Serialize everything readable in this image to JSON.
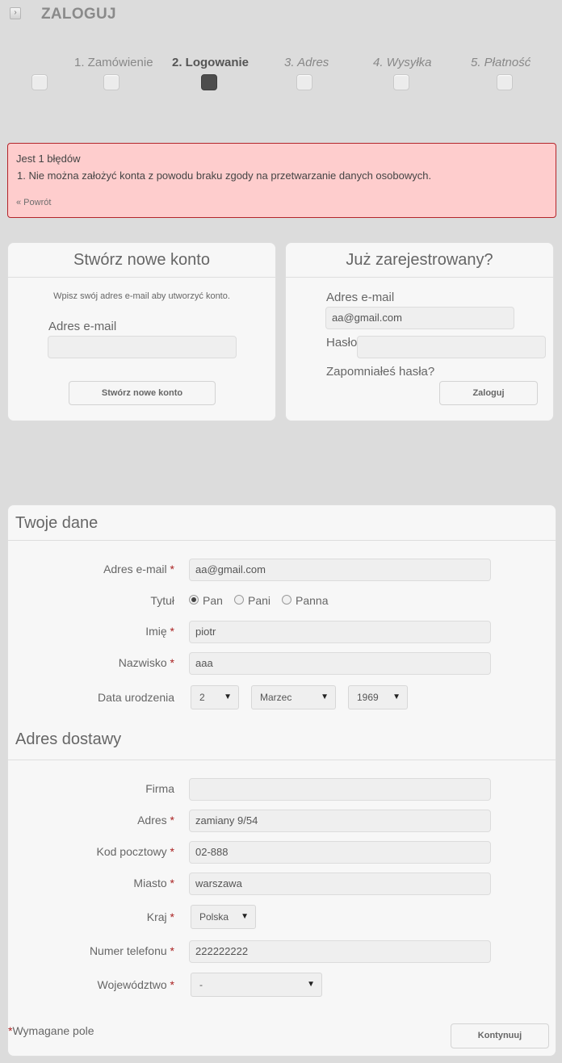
{
  "header": {
    "back_icon": "chevron-right-icon",
    "back_glyph": "›",
    "title": "ZALOGUJ"
  },
  "steps": [
    {
      "label": "1. Zamówienie",
      "active": false
    },
    {
      "label": "2. Logowanie",
      "active": true
    },
    {
      "label": "3. Adres",
      "active": false
    },
    {
      "label": "4. Wysyłka",
      "active": false
    },
    {
      "label": "5. Płatność",
      "active": false
    }
  ],
  "error": {
    "title": "Jest 1 błędów",
    "items": [
      "1.  Nie można założyć konta z powodu braku zgody na przetwarzanie danych osobowych."
    ],
    "back_link": "« Powrót",
    "border_color": "#b3252b",
    "bg_color": "#fecdcd"
  },
  "create_account": {
    "title": "Stwórz nowe konto",
    "hint": "Wpisz swój adres e-mail aby utworzyć konto.",
    "email_label": "Adres e-mail",
    "email_value": "",
    "button": "Stwórz nowe konto"
  },
  "login": {
    "title": "Już zarejestrowany?",
    "email_label": "Adres e-mail",
    "email_value": "aa@gmail.com",
    "password_label": "Hasło",
    "password_value": "",
    "forgot": "Zapomniałeś hasła?",
    "button": "Zaloguj"
  },
  "personal": {
    "title": "Twoje dane",
    "email_label": "Adres e-mail",
    "email_value": "aa@gmail.com",
    "title_label": "Tytuł",
    "title_options": [
      "Pan",
      "Pani",
      "Panna"
    ],
    "title_selected": "Pan",
    "firstname_label": "Imię",
    "firstname_value": "piotr",
    "lastname_label": "Nazwisko",
    "lastname_value": "aaa",
    "birth_label": "Data urodzenia",
    "birth_day": "2",
    "birth_month": "Marzec",
    "birth_year": "1969"
  },
  "address": {
    "title": "Adres dostawy",
    "company_label": "Firma",
    "company_value": "",
    "address_label": "Adres",
    "address_value": "zamiany 9/54",
    "postcode_label": "Kod pocztowy",
    "postcode_value": "02-888",
    "city_label": "Miasto",
    "city_value": "warszawa",
    "country_label": "Kraj",
    "country_value": "Polska",
    "phone_label": "Numer telefonu",
    "phone_value": "222222222",
    "state_label": "Województwo",
    "state_value": "-"
  },
  "footer": {
    "required_note": "Wymagane pole",
    "required_mark": "*",
    "continue": "Kontynuuj"
  },
  "required_mark": "*",
  "select_arrow": "▼",
  "accent": {
    "required": "#a22",
    "active_step": "#4d4d4d"
  }
}
